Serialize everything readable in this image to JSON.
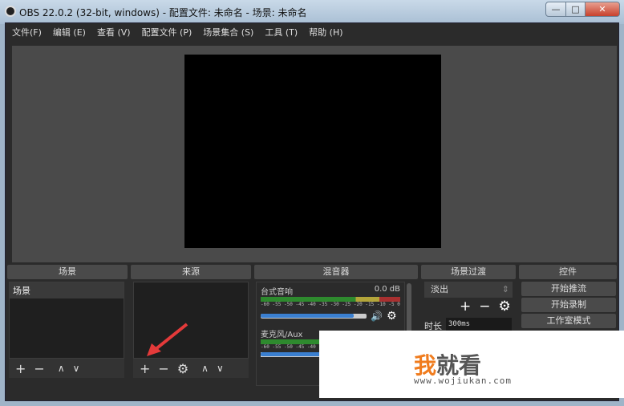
{
  "window": {
    "title": "OBS 22.0.2 (32-bit, windows) - 配置文件: 未命名 - 场景: 未命名",
    "minimize": "—",
    "maximize": "□",
    "close": "✕"
  },
  "menu": [
    "文件(F)",
    "编辑 (E)",
    "查看 (V)",
    "配置文件 (P)",
    "场景集合 (S)",
    "工具 (T)",
    "帮助 (H)"
  ],
  "docks": {
    "scenes": {
      "title": "场景",
      "items": [
        "场景"
      ]
    },
    "sources": {
      "title": "来源"
    },
    "mixer": {
      "title": "混音器",
      "channels": [
        {
          "name": "台式音响",
          "db": "0.0 dB",
          "volume": 0.88
        },
        {
          "name": "麦克风/Aux",
          "db": "",
          "volume": 0.88
        }
      ],
      "ticks": [
        "-60",
        "-55",
        "-50",
        "-45",
        "-40",
        "-35",
        "-30",
        "-25",
        "-20",
        "-15",
        "-10",
        "-5",
        "0"
      ]
    },
    "transitions": {
      "title": "场景过渡",
      "selected": "淡出",
      "duration_label": "时长",
      "duration": "300ms"
    },
    "controls": {
      "title": "控件",
      "buttons": [
        "开始推流",
        "开始录制",
        "工作室模式"
      ]
    }
  },
  "toolbar": {
    "add": "+",
    "remove": "−",
    "settings": "⚙",
    "up": "∧",
    "down": "∨"
  },
  "watermark": {
    "brand1": "我",
    "brand2": "就看",
    "url": "www.wojiukan.com",
    "accent": "#f07c1e"
  }
}
